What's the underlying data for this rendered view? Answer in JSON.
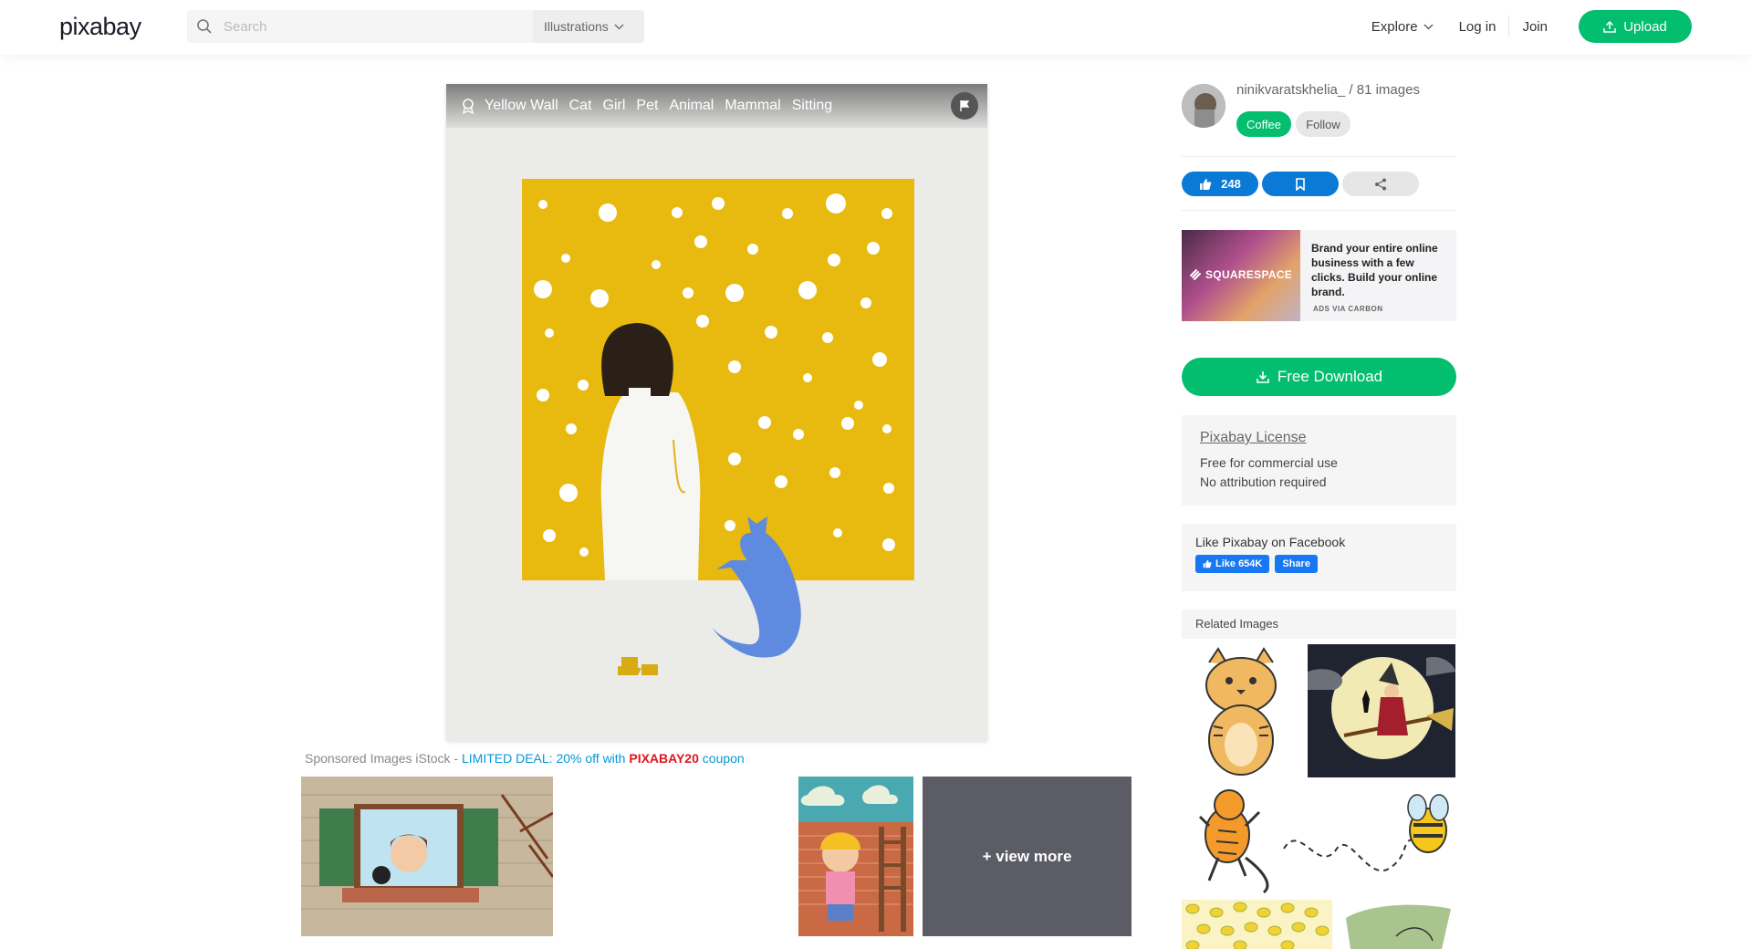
{
  "header": {
    "logo": "pixabay",
    "search_placeholder": "Search",
    "search_filter": "Illustrations",
    "nav": {
      "explore": "Explore",
      "login": "Log in",
      "join": "Join",
      "upload": "Upload"
    }
  },
  "image": {
    "tags": [
      "Yellow Wall",
      "Cat",
      "Girl",
      "Pet",
      "Animal",
      "Mammal",
      "Sitting"
    ]
  },
  "sponsored": {
    "prefix": "Sponsored Images iStock - ",
    "deal": "LIMITED DEAL: 20% off with ",
    "code": "PIXABAY20",
    "suffix": " coupon",
    "view_more": "+ view more"
  },
  "author": {
    "name": "ninikvaratskhelia_ / 81 images",
    "coffee": "Coffee",
    "follow": "Follow"
  },
  "actions": {
    "likes": "248"
  },
  "ad": {
    "brand": "SQUARESPACE",
    "text": "Brand your entire online business with a few clicks. Build your online brand.",
    "via": "ADS VIA CARBON"
  },
  "download": {
    "label": "Free Download"
  },
  "license": {
    "title": "Pixabay License",
    "line1": "Free for commercial use",
    "line2": "No attribution required"
  },
  "facebook": {
    "title": "Like Pixabay on Facebook",
    "like": "Like 654K",
    "share": "Share"
  },
  "related": {
    "heading": "Related Images"
  },
  "colors": {
    "brand_green": "#02be6e",
    "action_blue": "#0a7ad6",
    "wall_yellow": "#e8b90f",
    "cat_blue": "#5e8ae0"
  }
}
